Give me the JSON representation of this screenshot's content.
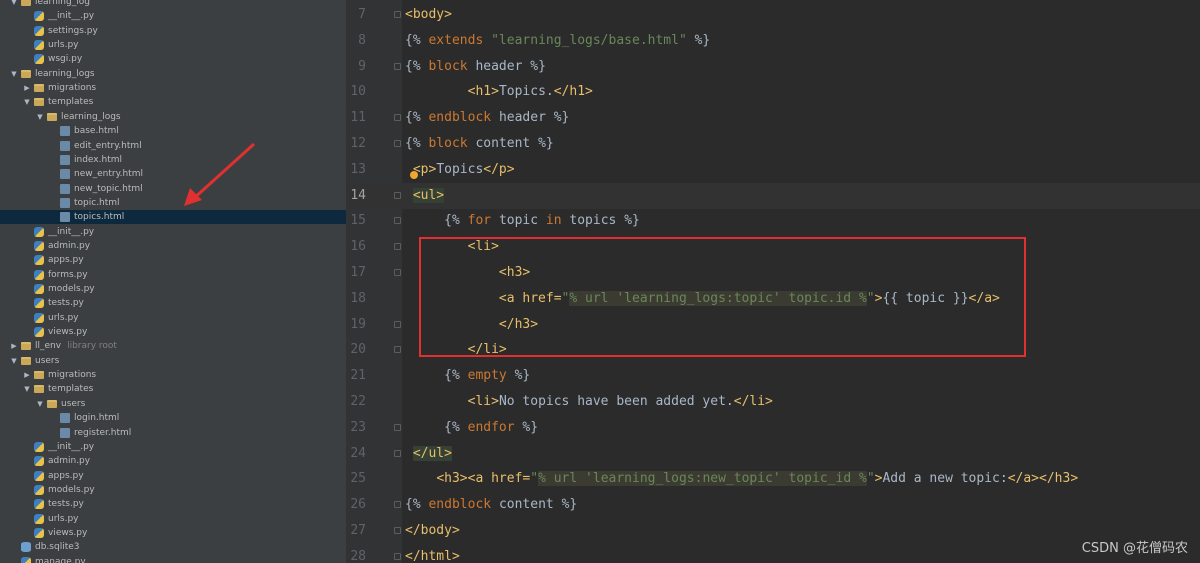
{
  "tree": [
    {
      "depth": 2,
      "type": "folder",
      "label": "learning_log",
      "expanded": true
    },
    {
      "depth": 3,
      "type": "py",
      "label": "__init__.py"
    },
    {
      "depth": 3,
      "type": "py",
      "label": "settings.py"
    },
    {
      "depth": 3,
      "type": "py",
      "label": "urls.py"
    },
    {
      "depth": 3,
      "type": "py",
      "label": "wsgi.py"
    },
    {
      "depth": 2,
      "type": "folder",
      "label": "learning_logs",
      "expanded": true
    },
    {
      "depth": 3,
      "type": "folder",
      "label": "migrations",
      "expanded": false
    },
    {
      "depth": 3,
      "type": "folder",
      "label": "templates",
      "expanded": true
    },
    {
      "depth": 4,
      "type": "folder",
      "label": "learning_logs",
      "expanded": true
    },
    {
      "depth": 5,
      "type": "html",
      "label": "base.html"
    },
    {
      "depth": 5,
      "type": "html",
      "label": "edit_entry.html"
    },
    {
      "depth": 5,
      "type": "html",
      "label": "index.html"
    },
    {
      "depth": 5,
      "type": "html",
      "label": "new_entry.html"
    },
    {
      "depth": 5,
      "type": "html",
      "label": "new_topic.html"
    },
    {
      "depth": 5,
      "type": "html",
      "label": "topic.html"
    },
    {
      "depth": 5,
      "type": "html",
      "label": "topics.html",
      "selected": true
    },
    {
      "depth": 3,
      "type": "py",
      "label": "__init__.py"
    },
    {
      "depth": 3,
      "type": "py",
      "label": "admin.py"
    },
    {
      "depth": 3,
      "type": "py",
      "label": "apps.py"
    },
    {
      "depth": 3,
      "type": "py",
      "label": "forms.py"
    },
    {
      "depth": 3,
      "type": "py",
      "label": "models.py"
    },
    {
      "depth": 3,
      "type": "py",
      "label": "tests.py"
    },
    {
      "depth": 3,
      "type": "py",
      "label": "urls.py"
    },
    {
      "depth": 3,
      "type": "py",
      "label": "views.py"
    },
    {
      "depth": 2,
      "type": "folder",
      "label": "ll_env",
      "hint": "library root",
      "expanded": false
    },
    {
      "depth": 2,
      "type": "folder",
      "label": "users",
      "expanded": true
    },
    {
      "depth": 3,
      "type": "folder",
      "label": "migrations",
      "expanded": false
    },
    {
      "depth": 3,
      "type": "folder",
      "label": "templates",
      "expanded": true
    },
    {
      "depth": 4,
      "type": "folder",
      "label": "users",
      "expanded": true
    },
    {
      "depth": 5,
      "type": "html",
      "label": "login.html"
    },
    {
      "depth": 5,
      "type": "html",
      "label": "register.html"
    },
    {
      "depth": 3,
      "type": "py",
      "label": "__init__.py"
    },
    {
      "depth": 3,
      "type": "py",
      "label": "admin.py"
    },
    {
      "depth": 3,
      "type": "py",
      "label": "apps.py"
    },
    {
      "depth": 3,
      "type": "py",
      "label": "models.py"
    },
    {
      "depth": 3,
      "type": "py",
      "label": "tests.py"
    },
    {
      "depth": 3,
      "type": "py",
      "label": "urls.py"
    },
    {
      "depth": 3,
      "type": "py",
      "label": "views.py"
    },
    {
      "depth": 2,
      "type": "db",
      "label": "db.sqlite3"
    },
    {
      "depth": 2,
      "type": "py",
      "label": "manage.py"
    }
  ],
  "code_lines": [
    {
      "n": "7",
      "fold": true,
      "tokens": [
        [
          "tag",
          "<body>"
        ]
      ]
    },
    {
      "n": "8",
      "tokens": [
        [
          "tpl",
          "{% "
        ],
        [
          "kw",
          "extends "
        ],
        [
          "str",
          "\"learning_logs/base.html\""
        ],
        [
          "tpl",
          " %}"
        ]
      ]
    },
    {
      "n": "9",
      "fold": true,
      "tokens": [
        [
          "tpl",
          "{% "
        ],
        [
          "kw",
          "block "
        ],
        [
          "pl",
          "header "
        ],
        [
          "tpl",
          "%}"
        ]
      ]
    },
    {
      "n": "10",
      "tokens": [
        [
          "pl",
          "        "
        ],
        [
          "tag",
          "<h1>"
        ],
        [
          "pl",
          "Topics."
        ],
        [
          "tag",
          "</h1>"
        ]
      ]
    },
    {
      "n": "11",
      "fold": true,
      "tokens": [
        [
          "tpl",
          "{% "
        ],
        [
          "kw",
          "endblock "
        ],
        [
          "pl",
          "header "
        ],
        [
          "tpl",
          "%}"
        ]
      ]
    },
    {
      "n": "12",
      "fold": true,
      "tokens": [
        [
          "tpl",
          "{% "
        ],
        [
          "kw",
          "block "
        ],
        [
          "pl",
          "content "
        ],
        [
          "tpl",
          "%}"
        ]
      ]
    },
    {
      "n": "13",
      "tokens": [
        [
          "pl",
          " "
        ],
        [
          "tag",
          "<p>"
        ],
        [
          "pl",
          "Topics"
        ],
        [
          "tag",
          "</p>"
        ]
      ]
    },
    {
      "n": "14",
      "fold": true,
      "current": true,
      "tokens": [
        [
          "pl",
          " "
        ],
        [
          "tag hl",
          "<ul>"
        ]
      ]
    },
    {
      "n": "15",
      "fold": true,
      "tokens": [
        [
          "pl",
          "     "
        ],
        [
          "tpl",
          "{% "
        ],
        [
          "kw",
          "for "
        ],
        [
          "pl",
          "topic "
        ],
        [
          "kw",
          "in "
        ],
        [
          "pl",
          "topics "
        ],
        [
          "tpl",
          "%}"
        ]
      ]
    },
    {
      "n": "16",
      "fold": true,
      "tokens": [
        [
          "pl",
          "        "
        ],
        [
          "tag",
          "<li>"
        ]
      ]
    },
    {
      "n": "17",
      "fold": true,
      "tokens": [
        [
          "pl",
          "            "
        ],
        [
          "tag",
          "<h3>"
        ]
      ]
    },
    {
      "n": "18",
      "tokens": [
        [
          "pl",
          "            "
        ],
        [
          "tag",
          "<a "
        ],
        [
          "tag",
          "href="
        ],
        [
          "str",
          "\""
        ],
        [
          "str hlstr",
          "% url 'learning_logs:topic' topic.id %"
        ],
        [
          "str",
          "\""
        ],
        [
          "tag",
          ">"
        ],
        [
          "pl",
          "{{ topic }}"
        ],
        [
          "tag",
          "</a>"
        ]
      ]
    },
    {
      "n": "19",
      "fold": true,
      "tokens": [
        [
          "pl",
          "            "
        ],
        [
          "tag",
          "</h3>"
        ]
      ]
    },
    {
      "n": "20",
      "fold": true,
      "tokens": [
        [
          "pl",
          "        "
        ],
        [
          "tag",
          "</li>"
        ]
      ]
    },
    {
      "n": "21",
      "tokens": [
        [
          "pl",
          "     "
        ],
        [
          "tpl",
          "{% "
        ],
        [
          "kw",
          "empty "
        ],
        [
          "tpl",
          "%}"
        ]
      ]
    },
    {
      "n": "22",
      "tokens": [
        [
          "pl",
          "        "
        ],
        [
          "tag",
          "<li>"
        ],
        [
          "pl",
          "No topics have been added yet."
        ],
        [
          "tag",
          "</li>"
        ]
      ]
    },
    {
      "n": "23",
      "fold": true,
      "tokens": [
        [
          "pl",
          "     "
        ],
        [
          "tpl",
          "{% "
        ],
        [
          "kw",
          "endfor "
        ],
        [
          "tpl",
          "%}"
        ]
      ]
    },
    {
      "n": "24",
      "fold": true,
      "tokens": [
        [
          "pl",
          " "
        ],
        [
          "tag hl",
          "</ul>"
        ]
      ]
    },
    {
      "n": "25",
      "tokens": [
        [
          "pl",
          "    "
        ],
        [
          "tag",
          "<h3><a "
        ],
        [
          "tag",
          "href="
        ],
        [
          "str",
          "\""
        ],
        [
          "str hlstr",
          "% url 'learning_logs:new_topic' topic_id %"
        ],
        [
          "str",
          "\""
        ],
        [
          "tag",
          ">"
        ],
        [
          "pl",
          "Add a new topic:"
        ],
        [
          "tag",
          "</a></h3>"
        ]
      ]
    },
    {
      "n": "26",
      "fold": true,
      "tokens": [
        [
          "tpl",
          "{% "
        ],
        [
          "kw",
          "endblock "
        ],
        [
          "pl",
          "content "
        ],
        [
          "tpl",
          "%}"
        ]
      ]
    },
    {
      "n": "27",
      "fold": true,
      "tokens": [
        [
          "tag",
          "</body>"
        ]
      ]
    },
    {
      "n": "28",
      "fold": true,
      "tokens": [
        [
          "tag",
          "</html>"
        ]
      ]
    }
  ],
  "watermark": "CSDN @花僧码农",
  "colors": {
    "annotation_red": "#e0302f",
    "selection": "#0d293e"
  }
}
